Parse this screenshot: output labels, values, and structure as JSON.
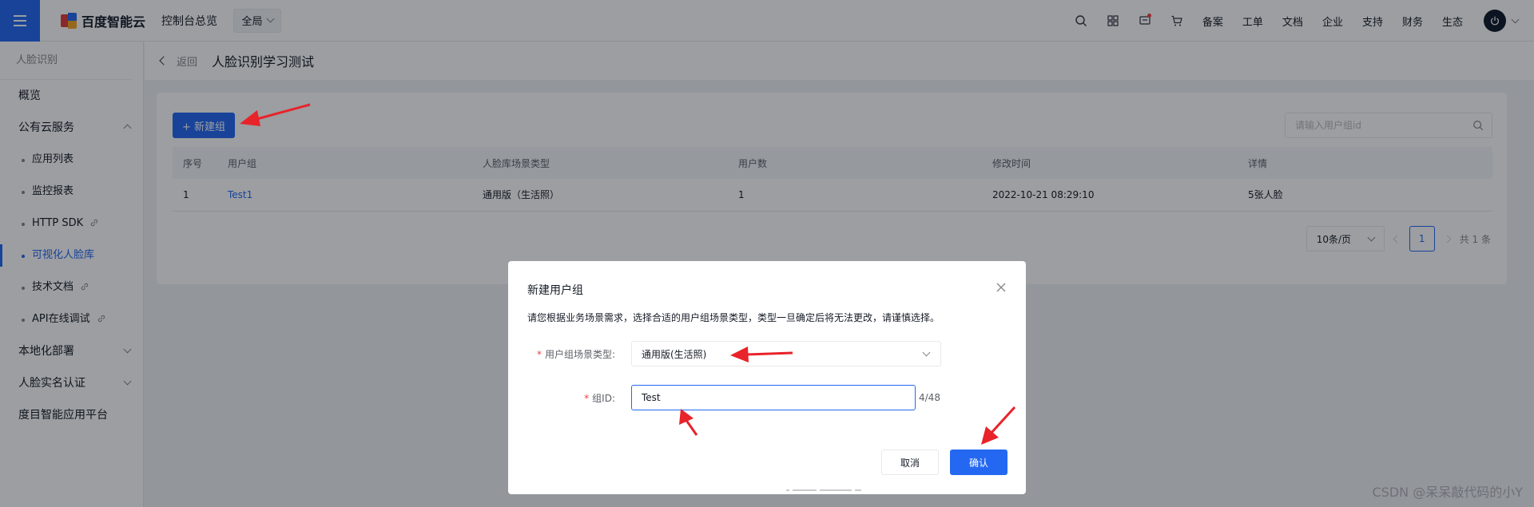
{
  "topbar": {
    "logo_text": "百度智能云",
    "console_label": "控制台总览",
    "region_label": "全局",
    "links": [
      "备案",
      "工单",
      "文档",
      "企业",
      "支持",
      "财务",
      "生态"
    ]
  },
  "sidebar": {
    "title": "人脸识别",
    "items": [
      {
        "label": "概览"
      },
      {
        "label": "公有云服务"
      },
      {
        "label": "应用列表"
      },
      {
        "label": "监控报表"
      },
      {
        "label": "HTTP SDK"
      },
      {
        "label": "可视化人脸库"
      },
      {
        "label": "技术文档"
      },
      {
        "label": "API在线调试"
      },
      {
        "label": "本地化部署"
      },
      {
        "label": "人脸实名认证"
      },
      {
        "label": "度目智能应用平台"
      }
    ]
  },
  "page_header": {
    "back_label": "返回",
    "title": "人脸识别学习测试"
  },
  "toolbar": {
    "new_group_label": "+ 新建组",
    "search_placeholder": "请输入用户组id"
  },
  "table": {
    "headers": [
      "序号",
      "用户组",
      "人脸库场景类型",
      "用户数",
      "修改时间",
      "详情"
    ],
    "rows": [
      [
        "1",
        "Test1",
        "通用版（生活照）",
        "1",
        "2022-10-21 08:29:10",
        "5张人脸"
      ]
    ]
  },
  "pagination": {
    "page_size": "10条/页",
    "current_page": "1",
    "total": "共 1 条"
  },
  "modal": {
    "title": "新建用户组",
    "description": "请您根据业务场景需求，选择合适的用户组场景类型，类型一旦确定后将无法更改，请谨慎选择。",
    "scene_label": "用户组场景类型:",
    "scene_value": "通用版(生活照)",
    "id_label": "组ID:",
    "id_value": "Test",
    "id_count": "4/48",
    "cancel_label": "取消",
    "confirm_label": "确认"
  },
  "watermark": "CSDN @呆呆敲代码的小Y",
  "colors": {
    "primary": "#2468f2",
    "annotation_arrow": "#e8232a"
  }
}
